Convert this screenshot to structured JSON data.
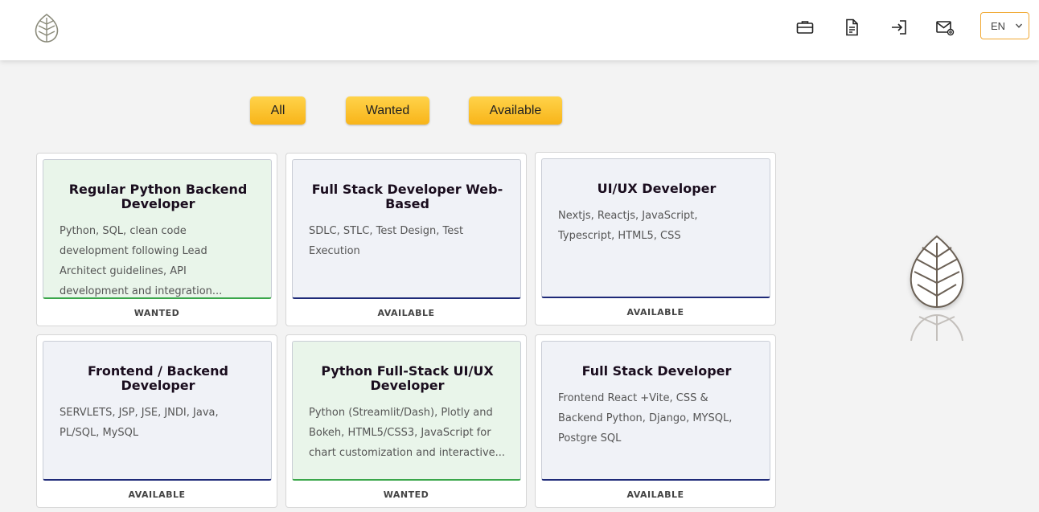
{
  "header": {
    "nav_icons": [
      "briefcase-icon",
      "document-icon",
      "login-icon",
      "mail-icon"
    ],
    "language": "EN"
  },
  "filters": {
    "all": "All",
    "wanted": "Wanted",
    "available": "Available"
  },
  "jobs": [
    {
      "title": "Regular Python Backend Developer",
      "description": "Python, SQL, clean code development following Lead Architect guidelines, API development and integration...",
      "status": "WANTED"
    },
    {
      "title": "Full Stack Developer Web-Based",
      "description": "SDLC, STLC, Test Design, Test Execution",
      "status": "AVAILABLE"
    },
    {
      "title": "UI/UX Developer",
      "description": "Nextjs, Reactjs, JavaScript, Typescript, HTML5, CSS",
      "status": "AVAILABLE"
    },
    {
      "title": "Frontend / Backend Developer",
      "description": "SERVLETS, JSP, JSE, JNDI, Java, PL/SQL, MySQL",
      "status": "AVAILABLE"
    },
    {
      "title": "Python Full-Stack UI/UX Developer",
      "description": "Python (Streamlit/Dash), Plotly and Bokeh, HTML5/CSS3, JavaScript for chart customization and interactive...",
      "status": "WANTED"
    },
    {
      "title": "Full Stack Developer",
      "description": "Frontend React +Vite, CSS & Backend Python, Django, MYSQL, Postgre SQL",
      "status": "AVAILABLE"
    }
  ],
  "colors": {
    "accent": "#f8b419",
    "wanted_border": "#3aa64a",
    "available_border": "#1e2a78",
    "wanted_bg": "#e9f5ea",
    "available_bg": "#f0f2f7"
  }
}
